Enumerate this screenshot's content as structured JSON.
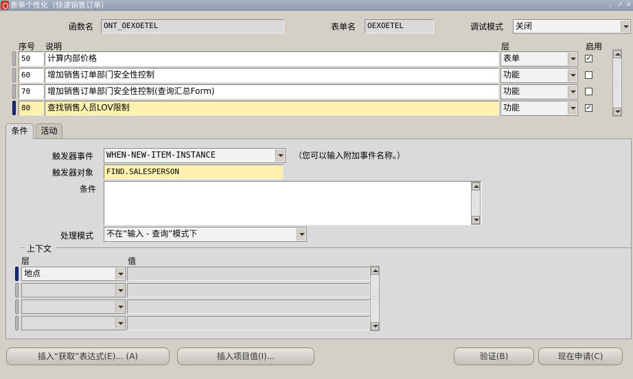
{
  "window": {
    "title": "表单个性化（快速销售订单）"
  },
  "header": {
    "function_label": "函数名",
    "function_value": "ONT_OEXOETEL",
    "form_label": "表单名",
    "form_value": "OEXOETEL",
    "debug_label": "调试模式",
    "debug_value": "关闭"
  },
  "rules": {
    "headers": {
      "seq": "序号",
      "desc": "说明",
      "level": "层",
      "enabled": "启用"
    },
    "rows": [
      {
        "seq": "50",
        "desc": "计算内部价格",
        "level": "表单",
        "enabled": true
      },
      {
        "seq": "60",
        "desc": "增加销售订单部门安全性控制",
        "level": "功能",
        "enabled": false
      },
      {
        "seq": "70",
        "desc": "增加销售订单部门安全性控制(查询汇总Form)",
        "level": "功能",
        "enabled": false
      },
      {
        "seq": "80",
        "desc": "查找销售人员LOV限制",
        "level": "功能",
        "enabled": true
      }
    ]
  },
  "tabs": {
    "conditions": "条件",
    "actions": "活动"
  },
  "condition": {
    "trigger_event_label": "触发器事件",
    "trigger_event_value": "WHEN-NEW-ITEM-INSTANCE",
    "trigger_hint": "（您可以输入附加事件名称。）",
    "trigger_object_label": "触发器对象",
    "trigger_object_value": "FIND.SALESPERSON",
    "condition_label": "条件",
    "condition_value": "",
    "mode_label": "处理模式",
    "mode_value": "不在“输入 - 查询”模式下"
  },
  "context": {
    "title": "上下文",
    "level_header": "层",
    "value_header": "值",
    "rows": [
      {
        "level": "地点",
        "value": ""
      },
      {
        "level": "",
        "value": ""
      },
      {
        "level": "",
        "value": ""
      },
      {
        "level": "",
        "value": ""
      }
    ]
  },
  "buttons": {
    "insert_get": "插入“获取”表达式(E)... (A)",
    "insert_item": "插入项目值(I)...",
    "validate": "验证(B)",
    "apply_now": "现在申请(C)"
  }
}
